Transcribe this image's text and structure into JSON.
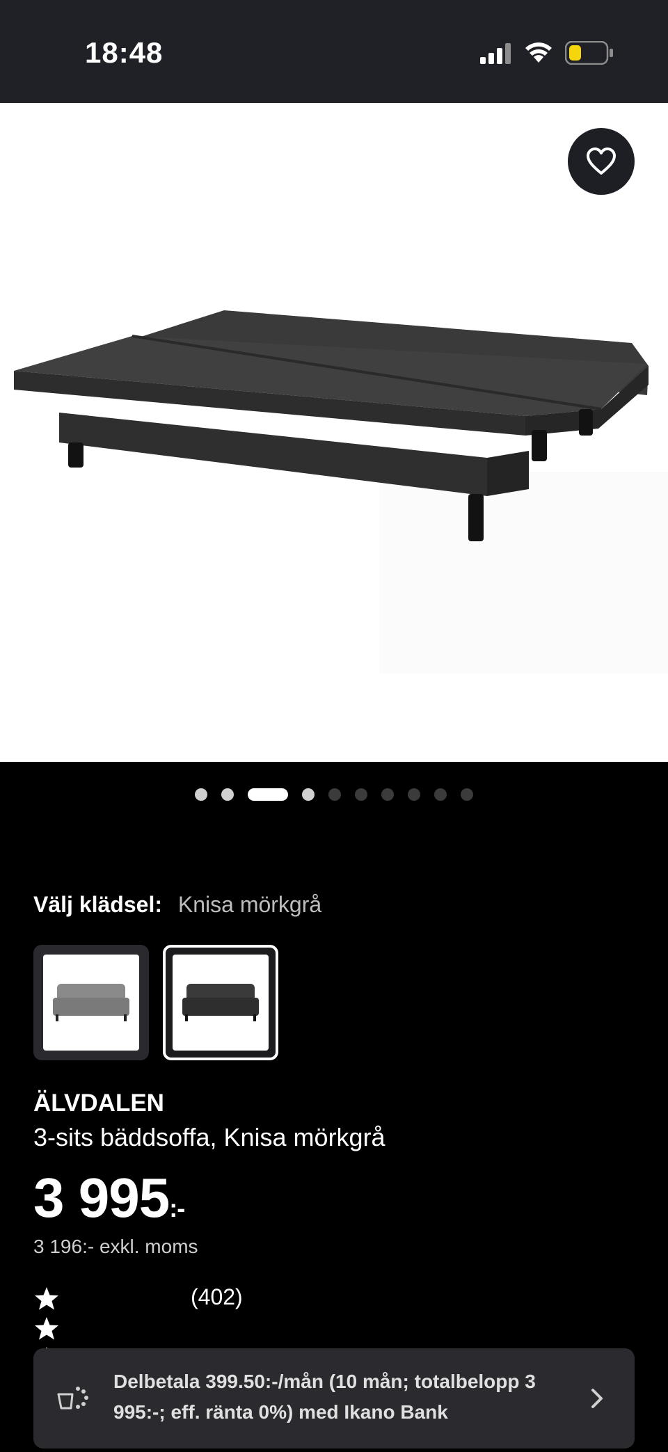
{
  "status_bar": {
    "time": "18:48",
    "icons": [
      "signal-icon",
      "wifi-icon",
      "battery-icon"
    ],
    "battery_color": "#f5d50b"
  },
  "gallery": {
    "favorite_icon": "heart-icon",
    "dot_count": 10,
    "active_index": 2
  },
  "fabric": {
    "label": "Välj klädsel:",
    "selected": "Knisa mörkgrå",
    "options": [
      {
        "name": "light-grey",
        "color": "#8a8a8a"
      },
      {
        "name": "dark-grey",
        "color": "#3a3a3a"
      }
    ]
  },
  "product": {
    "name": "ÄLVDALEN",
    "description": "3-sits bäddsoffa, Knisa mörkgrå",
    "price": "3 995",
    "price_suffix": ":-",
    "price_ex_vat": "3 196:- exkl. moms"
  },
  "rating": {
    "stars": 4.5,
    "max": 5,
    "count": "(402)"
  },
  "installment": {
    "text": "Delbetala 399.50:-/mån (10 mån; totalbelopp 3 995:-; eff. ränta 0%) med Ikano Bank",
    "icon": "payment-icon"
  }
}
